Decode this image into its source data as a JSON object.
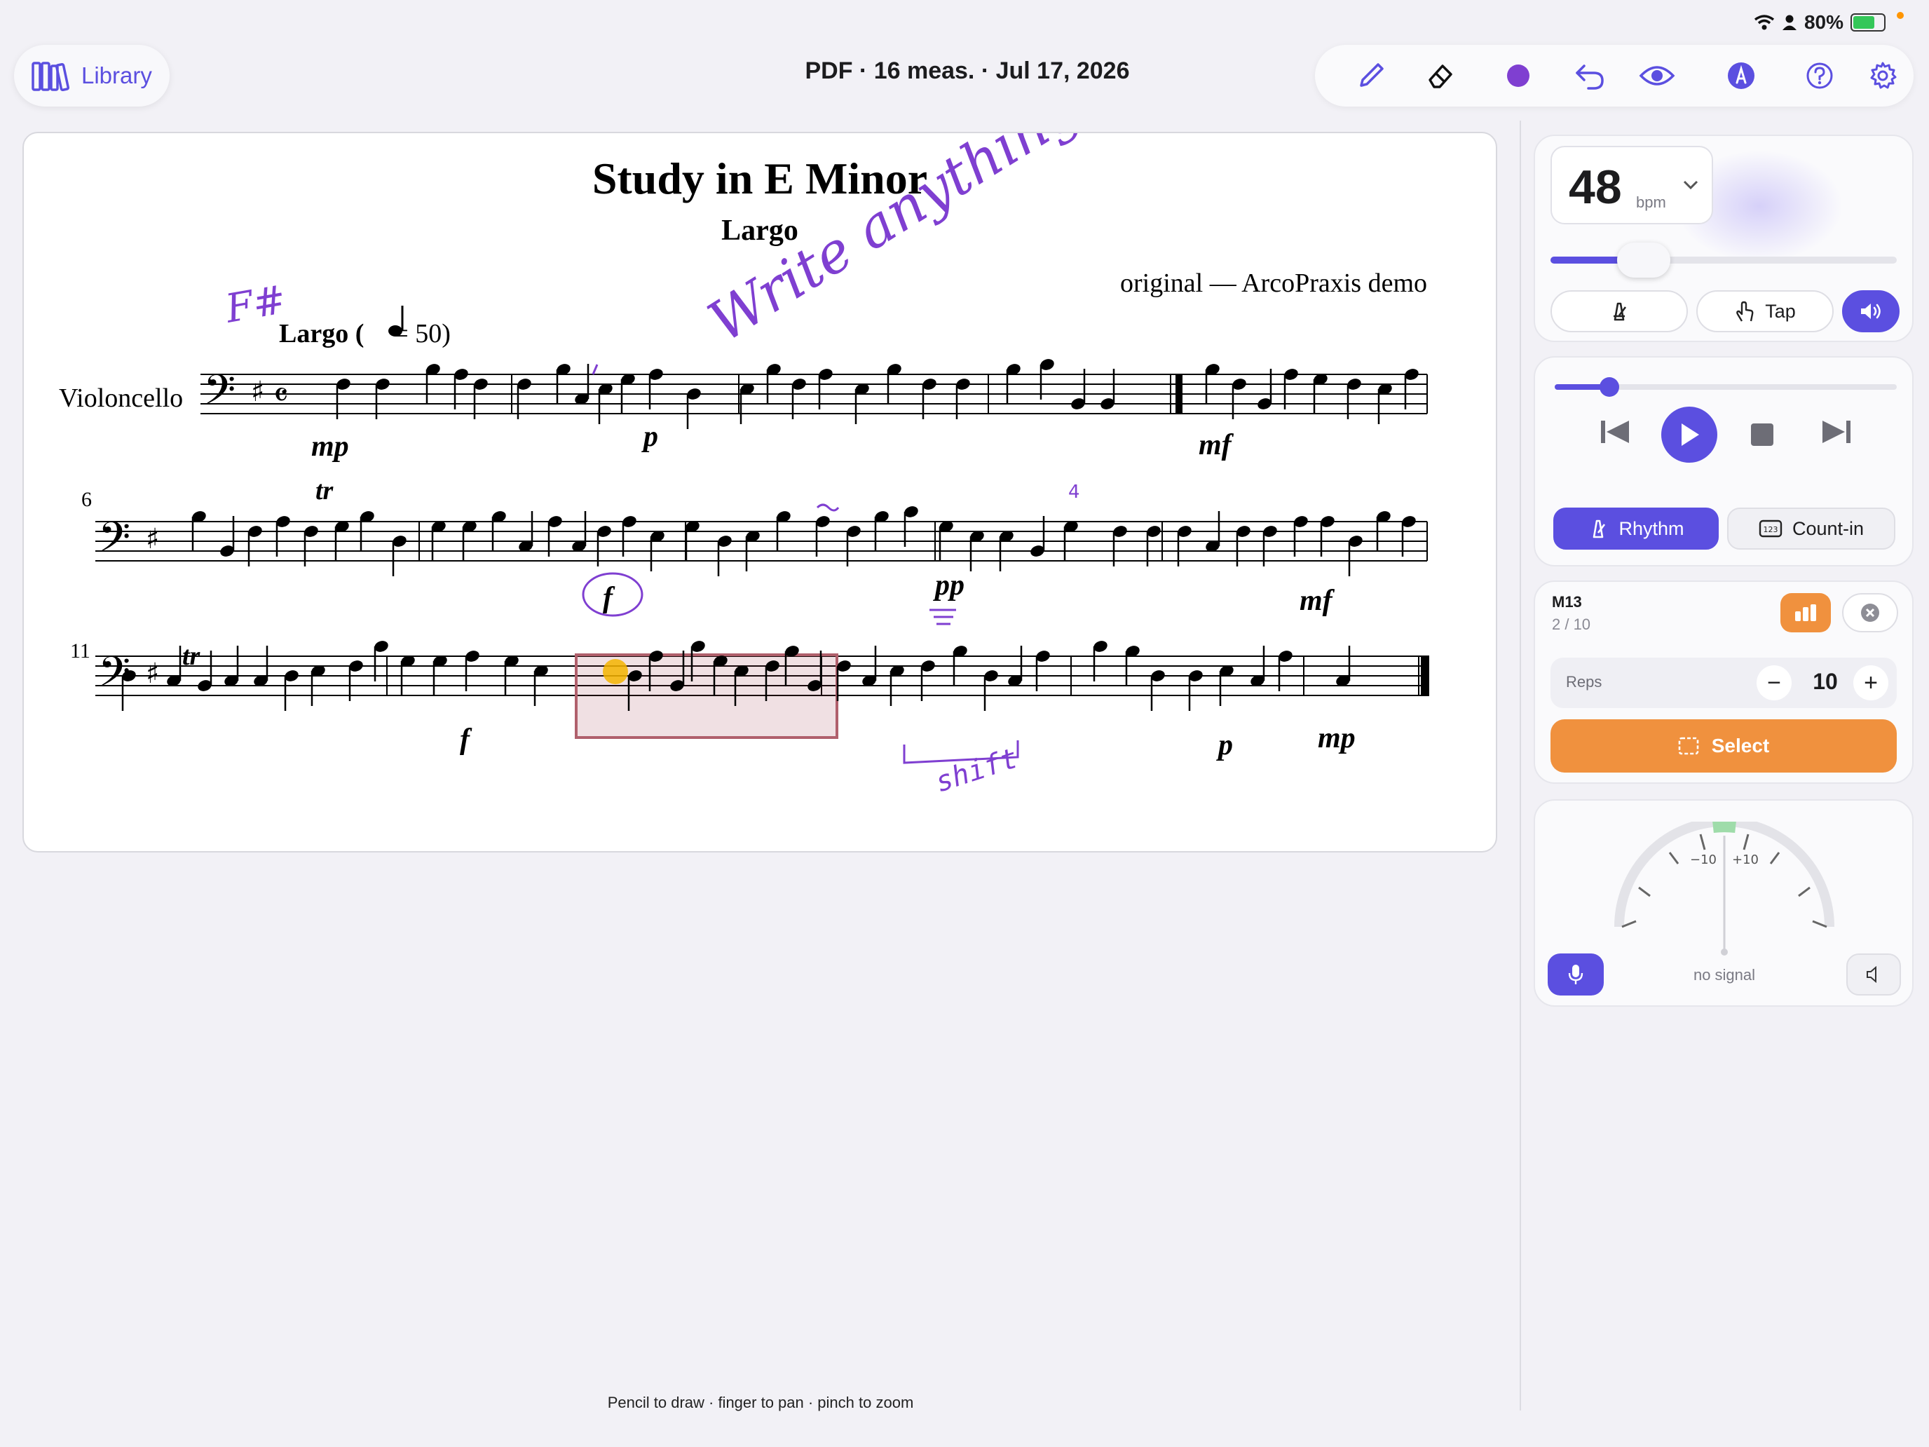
{
  "status_bar": {
    "battery": "80%"
  },
  "header": {
    "library_label": "Library",
    "document_title": "PDF · 16 meas. · Jul 17, 2026"
  },
  "toolbar": {
    "ink_color": "#7f3fd1",
    "accent": "#5b4fe0",
    "icons": [
      "pencil-icon",
      "eraser-icon",
      "color-swatch",
      "undo-icon",
      "eye-icon",
      "pen-tip-icon",
      "help-icon",
      "settings-icon"
    ]
  },
  "score": {
    "title": "Study in E Minor",
    "subtitle": "Largo",
    "composer": "original — ArcoPraxis demo",
    "tempo_text": "Largo (",
    "tempo_value": "= 50)",
    "instrument": "Violoncello",
    "measure_numbers": [
      "6",
      "11"
    ],
    "dynamics": [
      "mp",
      "p",
      "mf",
      "f",
      "pp",
      "mf",
      "f",
      "p",
      "mp"
    ],
    "ornament": "tr",
    "annotations": {
      "write_anything": "Write anything",
      "f_sharp": "F#",
      "fingering": "4",
      "shift": "shift"
    },
    "hint": "Pencil to draw · finger to pan · pinch to zoom"
  },
  "metronome": {
    "bpm": "48",
    "bpm_unit": "bpm",
    "tempo_fraction": 0.27,
    "tap_label": "Tap"
  },
  "transport": {
    "position_fraction": 0.16,
    "rhythm_label": "Rhythm",
    "count_in_label": "Count-in",
    "count_in_icon_text": "123"
  },
  "loop": {
    "measure": "M13",
    "progress": "2 / 10",
    "reps_label": "Reps",
    "reps_value": "10",
    "select_label": "Select",
    "accent": "#f0913e"
  },
  "tuner": {
    "minus_label": "−10",
    "plus_label": "+10",
    "status": "no signal"
  }
}
